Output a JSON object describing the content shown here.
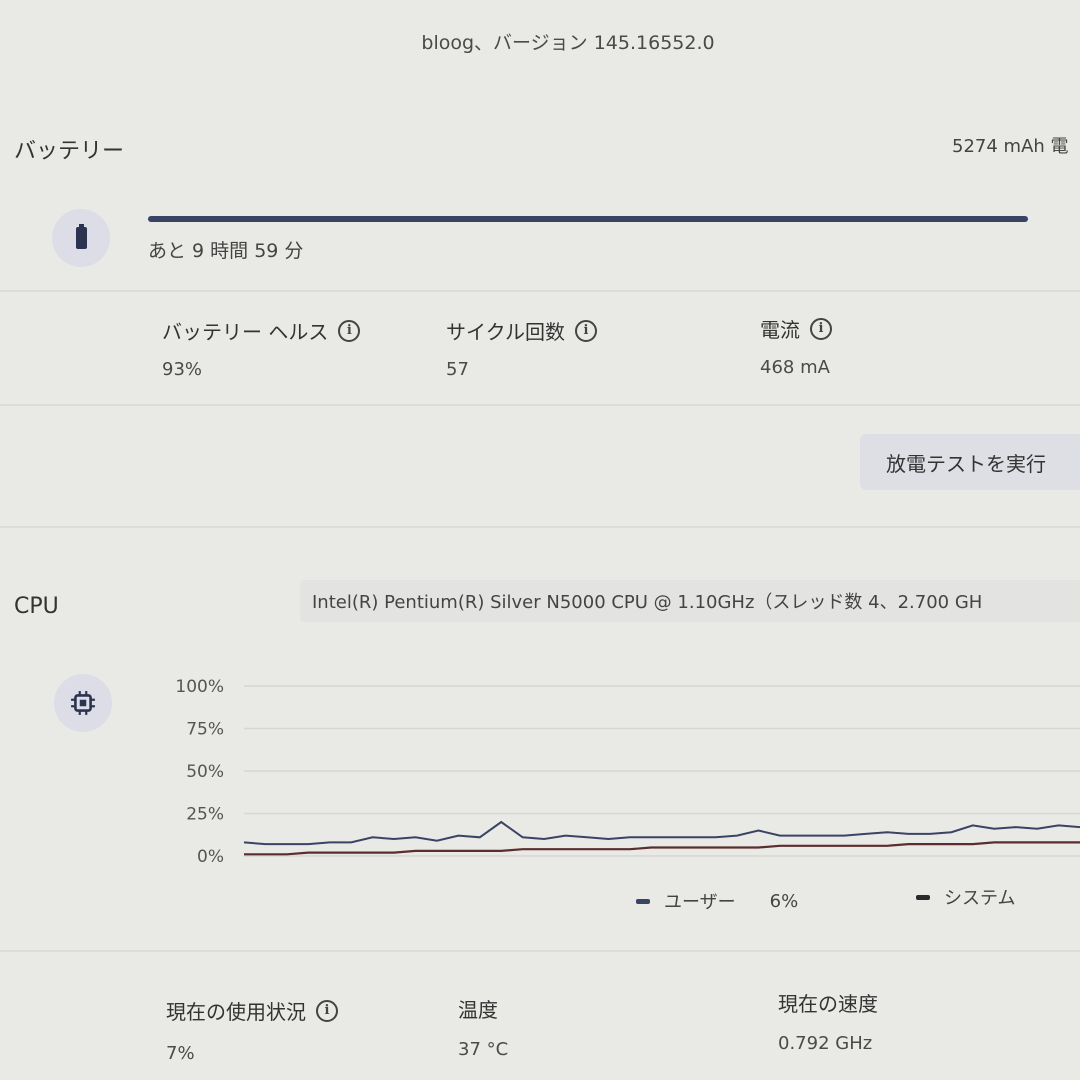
{
  "version_text": "bloog、バージョン 145.16552.0",
  "battery": {
    "title": "バッテリー",
    "capacity_text": "5274 mAh 電",
    "charge_fraction": 1.0,
    "remaining_text": "あと 9 時間 59 分",
    "icon": "battery-icon",
    "metrics": [
      {
        "label": "バッテリー ヘルス",
        "value": "93%",
        "has_info": true
      },
      {
        "label": "サイクル回数",
        "value": "57",
        "has_info": true
      },
      {
        "label": "電流",
        "value": "468 mA",
        "has_info": true
      }
    ],
    "test_button_label": "放電テストを実行"
  },
  "cpu": {
    "title": "CPU",
    "model_text": "Intel(R) Pentium(R) Silver N5000 CPU @ 1.10GHz（スレッド数 4、2.700 GH",
    "icon": "cpu-chip-icon",
    "legend": [
      {
        "label": "ユーザー",
        "value": "6%",
        "color": "#3b4365"
      },
      {
        "label": "システム",
        "value": "",
        "color": "#2a2a2a"
      }
    ],
    "metrics": [
      {
        "label": "現在の使用状況",
        "value": "7%",
        "has_info": true
      },
      {
        "label": "温度",
        "value": "37 °C",
        "has_info": false
      },
      {
        "label": "現在の速度",
        "value": "0.792 GHz",
        "has_info": false
      }
    ]
  },
  "chart_data": {
    "type": "line",
    "y_ticks": [
      "100%",
      "75%",
      "50%",
      "25%",
      "0%"
    ],
    "ylim": [
      0,
      100
    ],
    "x_count": 40,
    "grid": true,
    "series": [
      {
        "name": "ユーザー",
        "color": "#3b4365",
        "values": [
          8,
          7,
          7,
          7,
          8,
          8,
          11,
          10,
          11,
          9,
          12,
          11,
          20,
          11,
          10,
          12,
          11,
          10,
          11,
          11,
          11,
          11,
          11,
          12,
          15,
          12,
          12,
          12,
          12,
          13,
          14,
          13,
          13,
          14,
          18,
          16,
          17,
          16,
          18,
          17
        ]
      },
      {
        "name": "システム",
        "color": "#5a2e2e",
        "values": [
          1,
          1,
          1,
          2,
          2,
          2,
          2,
          2,
          3,
          3,
          3,
          3,
          3,
          4,
          4,
          4,
          4,
          4,
          4,
          5,
          5,
          5,
          5,
          5,
          5,
          6,
          6,
          6,
          6,
          6,
          6,
          7,
          7,
          7,
          7,
          8,
          8,
          8,
          8,
          8
        ]
      }
    ]
  }
}
